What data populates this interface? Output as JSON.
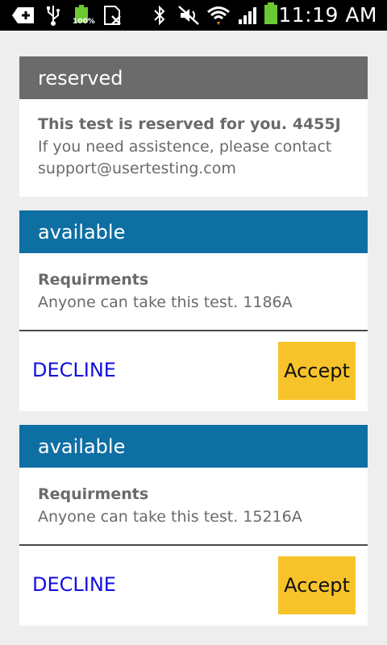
{
  "status_bar": {
    "time": "11:19 AM",
    "battery_text": "100%",
    "icons": [
      "add-icon",
      "usb-icon",
      "battery-full-icon",
      "no-sim-icon",
      "bluetooth-icon",
      "mute-icon",
      "wifi-icon",
      "signal-icon",
      "battery-icon"
    ]
  },
  "cards": [
    {
      "status": "reserved",
      "title": "This test is reserved for you. 4455J",
      "body": "If you need assistence, please contact support@usertesting.com"
    },
    {
      "status": "available",
      "title": "Requirments",
      "body": "Anyone can take this test. 1186A",
      "decline_label": "DECLINE",
      "accept_label": "Accept"
    },
    {
      "status": "available",
      "title": "Requirments",
      "body": "Anyone can take this test. 15216A",
      "decline_label": "DECLINE",
      "accept_label": "Accept"
    }
  ],
  "colors": {
    "reserved_header": "#6b6b6b",
    "available_header": "#0e6fa3",
    "accept_button": "#f6c32a",
    "decline_text": "#1010e0"
  }
}
